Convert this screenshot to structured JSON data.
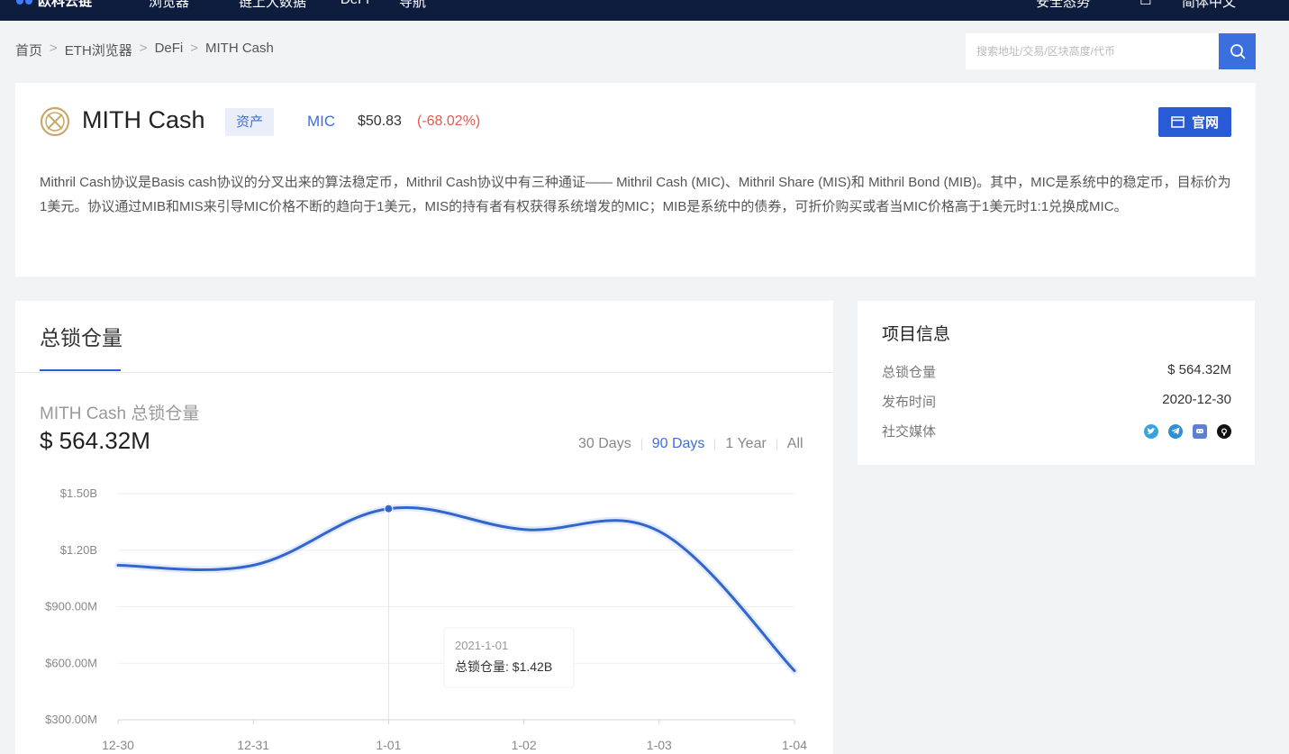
{
  "nav": {
    "logo_text": "欧科云链",
    "items": [
      "浏览器",
      "链上大数据",
      "DeFi",
      "导航"
    ],
    "right_items": [
      "安全态势",
      "简体中文"
    ]
  },
  "breadcrumb": [
    "首页",
    "ETH浏览器",
    "DeFi",
    "MITH Cash"
  ],
  "breadcrumb_sep": ">",
  "search": {
    "placeholder": "搜索地址/交易/区块高度/代币"
  },
  "coin": {
    "name": "MITH Cash",
    "tag": "资产",
    "symbol": "MIC",
    "price": "$50.83",
    "change": "(-68.02%)",
    "site_button": "官网",
    "description": "Mithril Cash协议是Basis cash协议的分叉出来的算法稳定币，Mithril Cash协议中有三种通证—— Mithril Cash (MIC)、Mithril Share (MIS)和 Mithril Bond (MIB)。其中，MIC是系统中的稳定币，目标价为1美元。协议通过MIB和MIS来引导MIC价格不断的趋向于1美元，MIS的持有者有权获得系统增发的MIC；MIB是系统中的债券，可折价购买或者当MIC价格高于1美元时1:1兑换成MIC。",
    "logo_color": "#c8a96a"
  },
  "tvl": {
    "tab_title": "总锁仓量",
    "chart_subtitle": "MITH Cash 总锁仓量",
    "big_value": "$ 564.32M",
    "ranges": [
      {
        "label": "30 Days",
        "active": false
      },
      {
        "label": "90 Days",
        "active": true
      },
      {
        "label": "1 Year",
        "active": false
      },
      {
        "label": "All",
        "active": false
      }
    ],
    "tooltip": {
      "date": "2021-1-01",
      "label": "总锁仓量: $1.42B"
    }
  },
  "chart_data": {
    "type": "line",
    "x": [
      "12-30",
      "12-31",
      "1-01",
      "1-02",
      "1-03",
      "1-04"
    ],
    "series": [
      {
        "name": "",
        "values": [
          1.12,
          1.12,
          1.42,
          1.31,
          1.3,
          0.56
        ]
      }
    ],
    "y_tick_labels": [
      "$300.00M",
      "$600.00M",
      "$900.00M",
      "$1.20B",
      "$1.50B"
    ],
    "y_ticks": [
      0.3,
      0.6,
      0.9,
      1.2,
      1.5
    ],
    "ylim": [
      0.3,
      1.5
    ],
    "y_unit": "B USD",
    "highlight_index": 2,
    "line_color": "#3366cc",
    "grid": true
  },
  "info": {
    "title": "项目信息",
    "rows": [
      {
        "key": "总锁仓量",
        "value": "$ 564.32M"
      },
      {
        "key": "发布时间",
        "value": "2020-12-30"
      },
      {
        "key": "社交媒体",
        "value": ""
      }
    ],
    "social_icons": [
      "twitter-icon",
      "telegram-icon",
      "discord-icon",
      "github-icon"
    ]
  },
  "colors": {
    "accent": "#2a5bd7",
    "negative": "#e05a4f",
    "nav_bg": "#0e1c3e"
  }
}
